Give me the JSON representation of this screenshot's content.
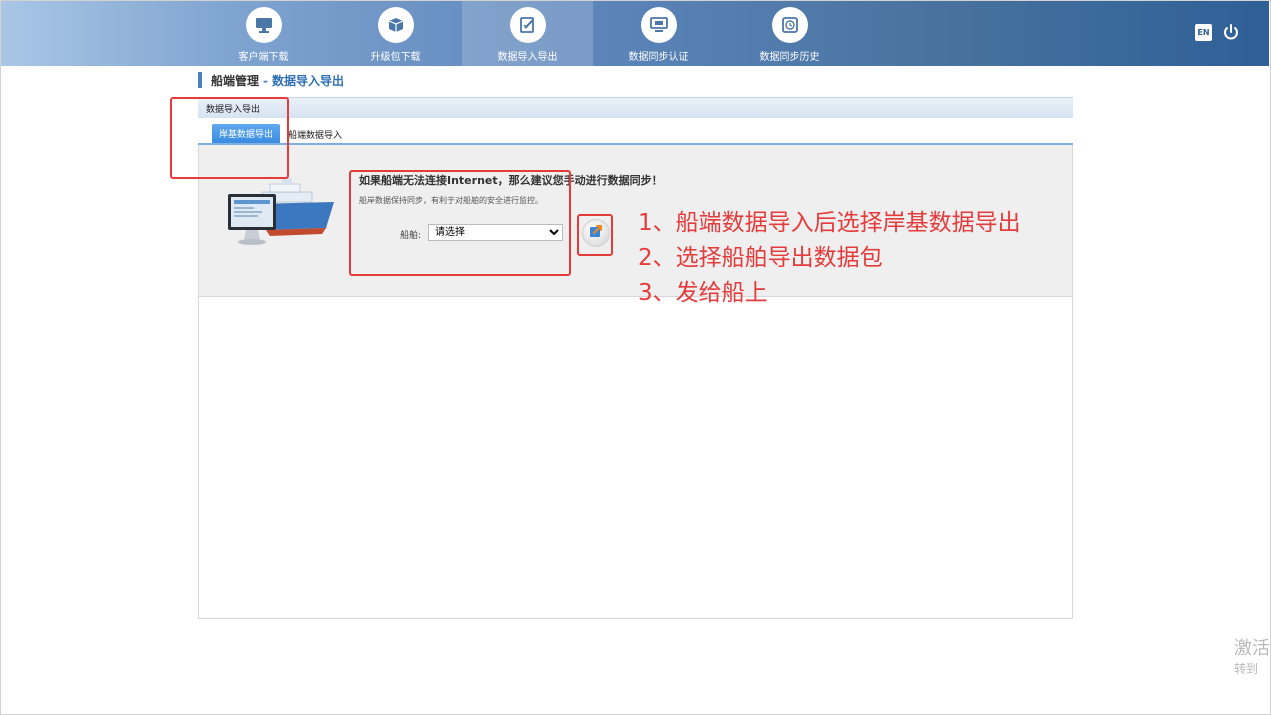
{
  "nav": {
    "items": [
      {
        "label": "客户端下载",
        "icon": "monitor-icon"
      },
      {
        "label": "升级包下载",
        "icon": "package-icon"
      },
      {
        "label": "数据导入导出",
        "icon": "edit-doc-icon"
      },
      {
        "label": "数据同步认证",
        "icon": "sync-screen-icon"
      },
      {
        "label": "数据同步历史",
        "icon": "history-icon"
      }
    ],
    "active_index": 2,
    "lang_label": "EN"
  },
  "breadcrumb": {
    "parent": "船端管理",
    "separator": "-",
    "current": "数据导入导出"
  },
  "panel": {
    "title": "数据导入导出",
    "tabs": [
      {
        "label": "岸基数据导出",
        "active": true
      },
      {
        "label": "船端数据导入",
        "active": false
      }
    ]
  },
  "content": {
    "main_message": "如果船端无法连接Internet，那么建议您手动进行数据同步！",
    "sub_message": "船岸数据保持同步，有利于对船舶的安全进行监控。",
    "ship_label": "船舶:",
    "ship_select_value": "请选择"
  },
  "annotations": {
    "lines": [
      "1、船端数据导入后选择岸基数据导出",
      "2、选择船舶导出数据包",
      "3、发给船上"
    ],
    "color": "#e53b3b"
  },
  "watermark": {
    "line1": "激活",
    "line2": "转到"
  },
  "colors": {
    "accent": "#2e6fb5",
    "tab_active": "#3a8ce0",
    "highlight": "#e53b3b"
  }
}
